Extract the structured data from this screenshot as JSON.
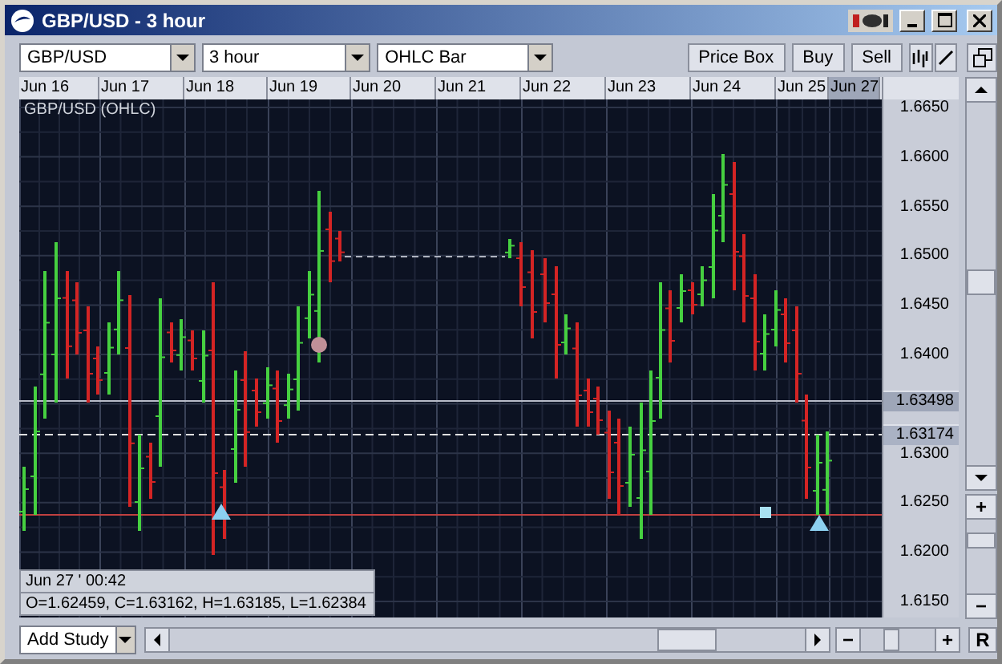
{
  "window": {
    "title": "GBP/USD - 3 hour"
  },
  "toolbar": {
    "dropdowns": [
      {
        "value": "GBP/USD"
      },
      {
        "value": "3 hour"
      },
      {
        "value": "OHLC Bar"
      }
    ],
    "buttons": [
      "Price Box",
      "Buy",
      "Sell"
    ]
  },
  "date_axis": [
    {
      "label": "Jun 16",
      "highlighted": false
    },
    {
      "label": "Jun 17",
      "highlighted": false
    },
    {
      "label": "Jun 18",
      "highlighted": false
    },
    {
      "label": "Jun 19",
      "highlighted": false
    },
    {
      "label": "Jun 20",
      "highlighted": false
    },
    {
      "label": "Jun 21",
      "highlighted": false
    },
    {
      "label": "Jun 22",
      "highlighted": false
    },
    {
      "label": "Jun 23",
      "highlighted": false
    },
    {
      "label": "Jun 24",
      "highlighted": false
    },
    {
      "label": "Jun 25",
      "highlighted": false
    },
    {
      "label": "Jun 27",
      "highlighted": true
    }
  ],
  "chart": {
    "legend": "GBP/USD (OHLC)",
    "price_axis": [
      "1.6650",
      "1.6600",
      "1.6550",
      "1.6500",
      "1.6450",
      "1.6400",
      "1.6300",
      "1.6250",
      "1.6200",
      "1.6150"
    ],
    "price_markers": [
      {
        "label": "1.63498",
        "kind": "solid"
      },
      {
        "label": "1.63174",
        "kind": "dashed"
      }
    ],
    "info": [
      "Jun 27 ' 00:42",
      "O=1.62459, C=1.63162, H=1.63185, L=1.62384"
    ]
  },
  "vertical_zoom": {
    "plus": "+",
    "minus": "−"
  },
  "bottom_bar": {
    "study": "Add Study",
    "minus": "−",
    "plus": "+",
    "reset": "R"
  }
}
